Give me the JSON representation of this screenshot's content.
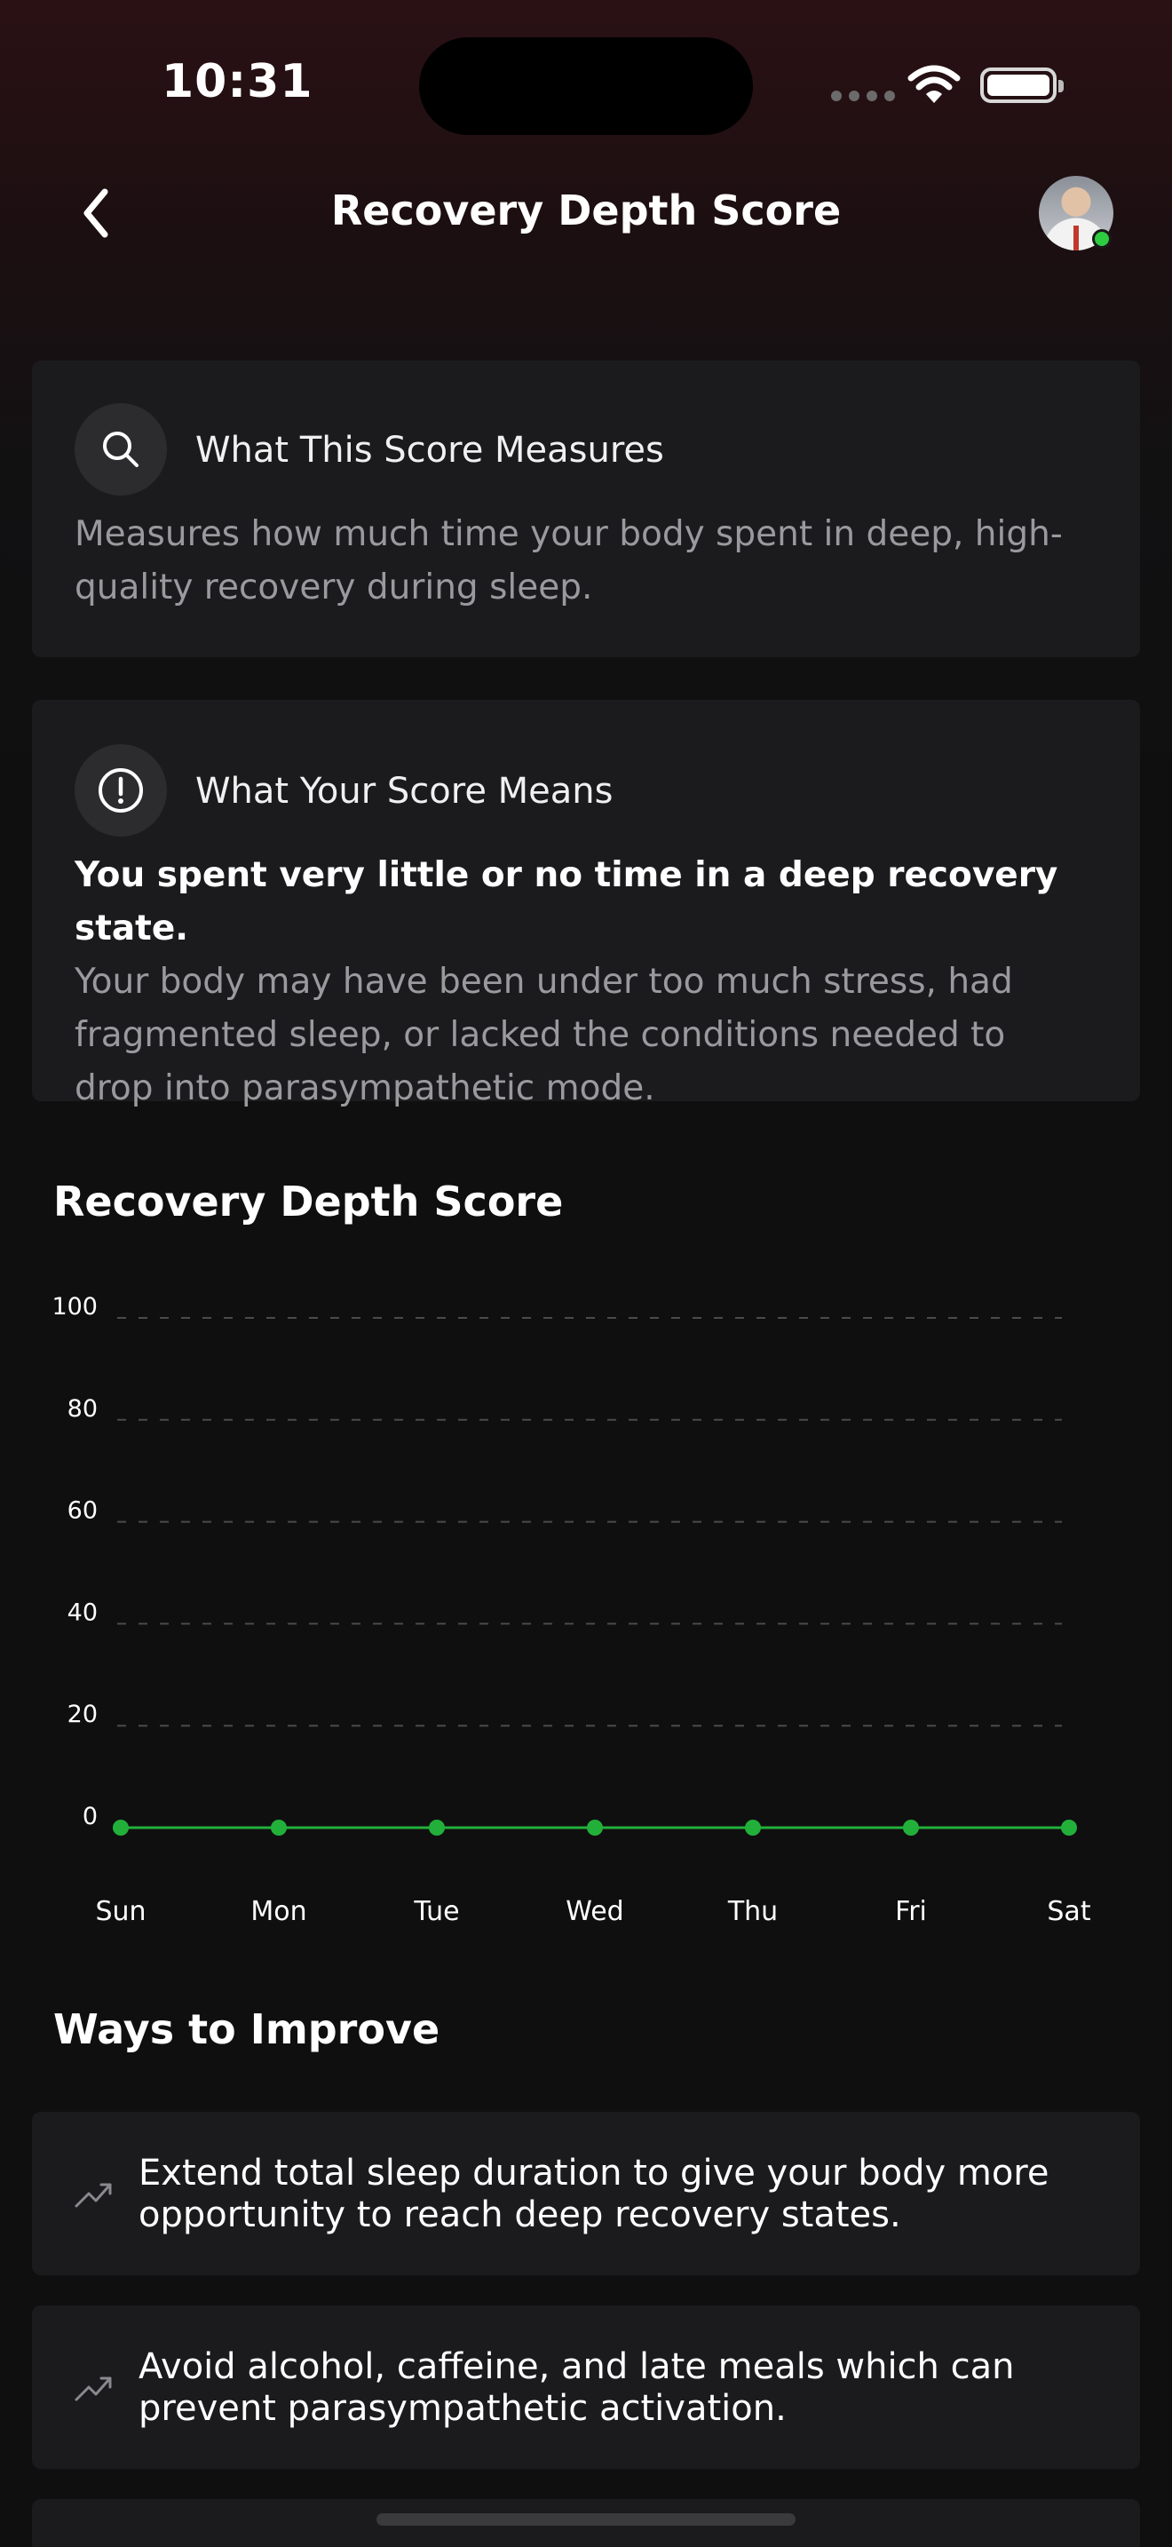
{
  "status_bar": {
    "time": "10:31"
  },
  "nav": {
    "title": "Recovery Depth Score"
  },
  "measures_card": {
    "title": "What This Score Measures",
    "body": "Measures how much time your body spent in deep, high-quality recovery during sleep."
  },
  "means_card": {
    "title": "What Your Score Means",
    "headline": "You spent very little or no time in a deep recovery state.",
    "body": "Your body may have been under too much stress, had fragmented sleep, or lacked the conditions needed to drop into parasympathetic mode."
  },
  "chart_heading": "Recovery Depth Score",
  "chart_data": {
    "type": "line",
    "categories": [
      "Sun",
      "Mon",
      "Tue",
      "Wed",
      "Thu",
      "Fri",
      "Sat"
    ],
    "series": [
      {
        "values": [
          0,
          0,
          0,
          0,
          0,
          0,
          0
        ]
      }
    ],
    "yticks": [
      100,
      80,
      60,
      40,
      20,
      0
    ],
    "ylim": [
      0,
      100
    ],
    "grid": true,
    "line_color": "#22b03a"
  },
  "improve": {
    "heading": "Ways to Improve",
    "tips": [
      {
        "icon": "trending-up-icon",
        "text": "Extend total sleep duration to give your body more opportunity to reach deep recovery states."
      },
      {
        "icon": "trending-up-icon",
        "text": "Avoid alcohol, caffeine, and late meals which can prevent parasympathetic activation."
      }
    ]
  },
  "colors": {
    "accent": "#22b03a",
    "card": "#1b1b1d",
    "online": "#2ecc40"
  }
}
